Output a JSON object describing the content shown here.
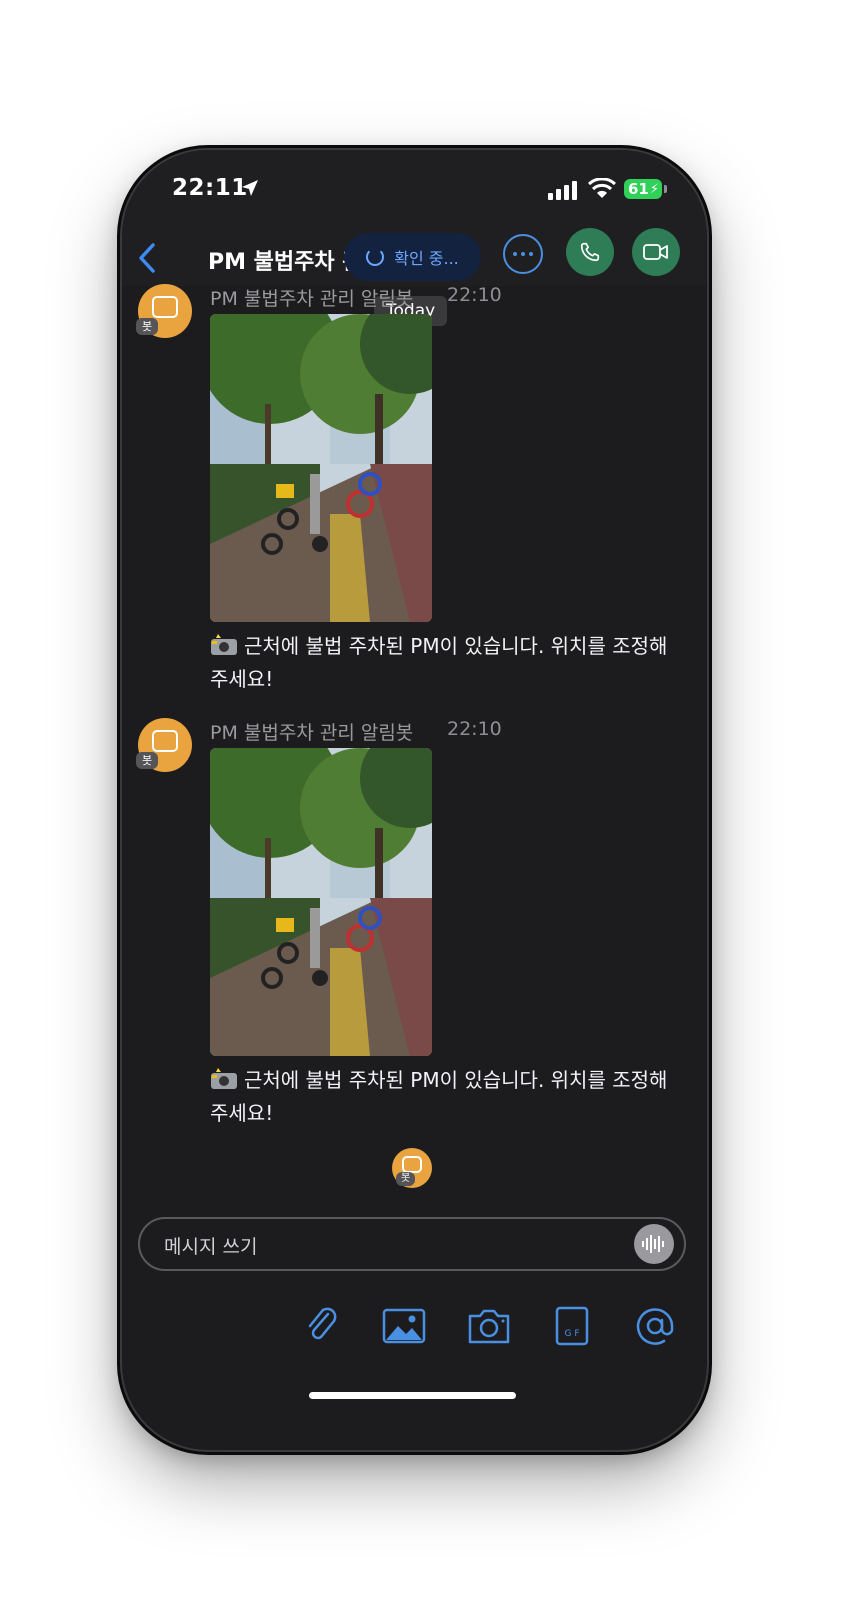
{
  "status": {
    "time": "22:11",
    "battery": "61"
  },
  "header": {
    "title": "PM 불법주차 관리 알림봇",
    "checking_label": "확인 중..."
  },
  "date_divider": "Today",
  "messages": [
    {
      "sender": "PM 불법주차 관리 알림봇",
      "time": "22:10",
      "avatar_badge": "봇",
      "text": "근처에 불법 주차된 PM이 있습니다. 위치를 조정해주세요!"
    },
    {
      "sender": "PM 불법주차 관리 알림봇",
      "time": "22:10",
      "avatar_badge": "봇",
      "text": "근처에 불법 주차된 PM이 있습니다. 위치를 조정해주세요!"
    }
  ],
  "read_receipt_badge": "봇",
  "composer": {
    "placeholder": "메시지 쓰기"
  },
  "toolbar": [
    "paperclip-icon",
    "image-icon",
    "camera-icon",
    "gif-icon",
    "mention-icon"
  ],
  "colors": {
    "accent": "#4a90e2",
    "call_green": "#2f7d57",
    "avatar": "#e9a43f",
    "background": "#1c1c1e"
  }
}
